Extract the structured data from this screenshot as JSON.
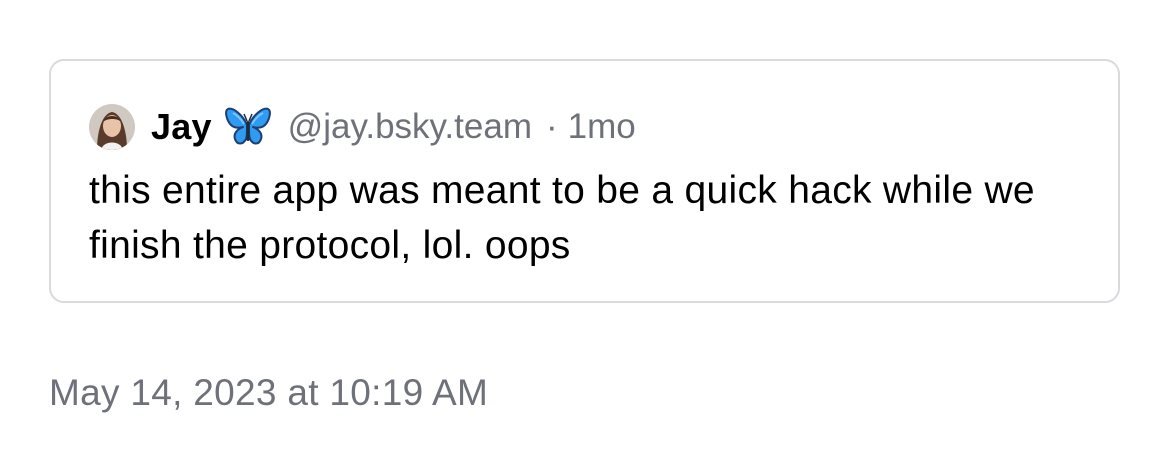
{
  "quoted_post": {
    "author": {
      "display_name": "Jay",
      "badge_icon": "butterfly-icon",
      "handle": "@jay.bsky.team",
      "avatar_icon": "avatar"
    },
    "separator": "·",
    "time_ago": "1mo",
    "text": "this entire app was meant to be a quick hack while we finish the protocol, lol. oops"
  },
  "timestamp": "May 14, 2023 at 10:19 AM",
  "colors": {
    "text": "#000000",
    "muted": "#6e717a",
    "border": "#d9dadd",
    "butterfly": "#2f9bf2"
  }
}
